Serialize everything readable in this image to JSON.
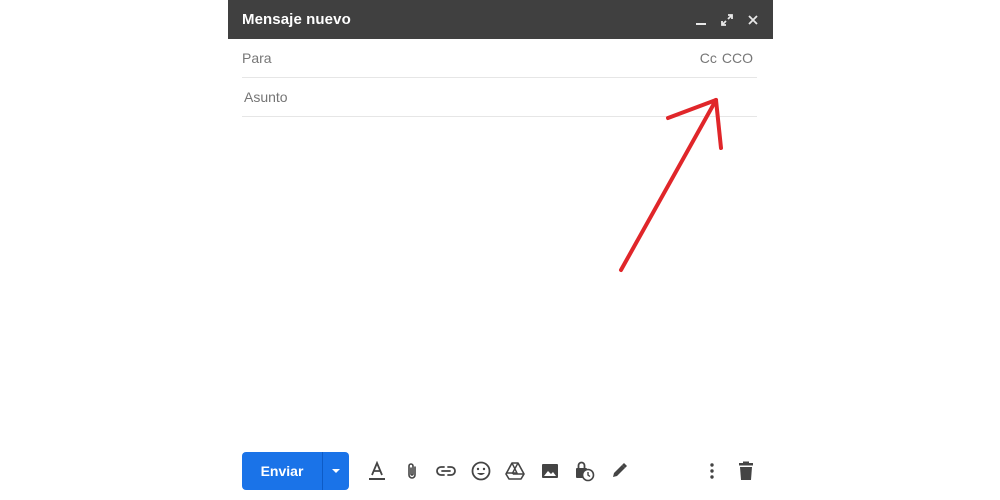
{
  "window": {
    "title": "Mensaje nuevo"
  },
  "fields": {
    "to_label": "Para",
    "cc_label": "Cc",
    "bcc_label": "CCO",
    "subject_placeholder": "Asunto"
  },
  "toolbar": {
    "send_label": "Enviar",
    "icons": [
      "text-format-icon",
      "attach-file-icon",
      "insert-link-icon",
      "emoji-icon",
      "google-drive-icon",
      "insert-photo-icon",
      "confidential-mode-icon",
      "signature-icon",
      "more-options-icon",
      "discard-draft-icon"
    ]
  },
  "colors": {
    "titlebar": "#404040",
    "send_button": "#1a73e8",
    "icon": "#444444",
    "annotation_arrow": "#e0262a"
  }
}
